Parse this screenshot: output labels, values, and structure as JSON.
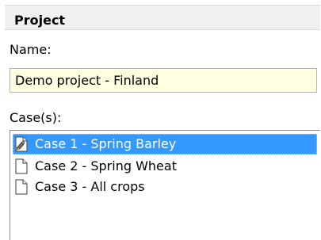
{
  "project": {
    "header": "Project",
    "name_label": "Name:",
    "name_value": "Demo project - Finland",
    "cases_label": "Case(s):"
  },
  "cases": [
    {
      "label": "Case 1 - Spring Barley",
      "selected": true,
      "icon": "case-edit-icon"
    },
    {
      "label": "Case 2 - Spring Wheat",
      "selected": false,
      "icon": "document-icon"
    },
    {
      "label": "Case 3 - All crops",
      "selected": false,
      "icon": "document-icon"
    }
  ],
  "colors": {
    "selection": "#3399ff",
    "input_background": "#ffffe1",
    "header_background": "#f0f0f0"
  }
}
